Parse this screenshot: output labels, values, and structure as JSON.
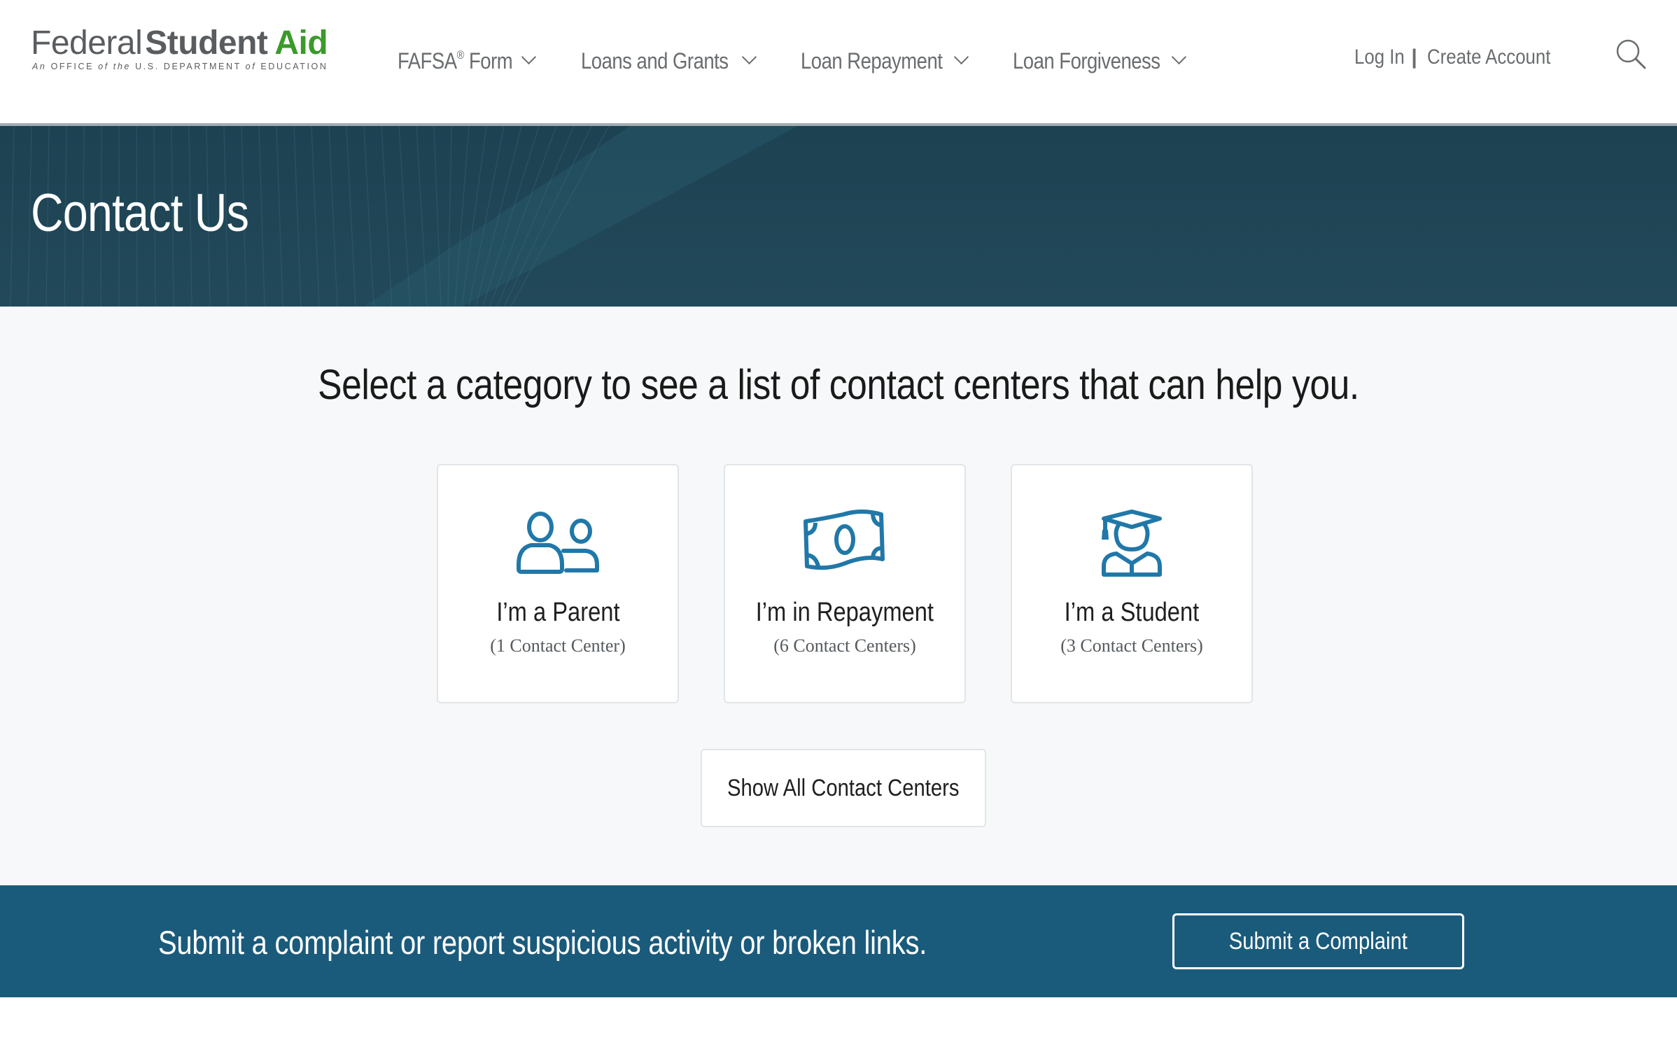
{
  "header": {
    "logo": {
      "word1": "Federal",
      "word2": "Student",
      "word3": "Aid",
      "tagline_parts": [
        "An",
        "OFFICE",
        "of",
        "the",
        "U.S. DEPARTMENT",
        "of",
        "EDUCATION"
      ]
    },
    "nav": [
      {
        "label": "FAFSA",
        "sup": "®",
        "suffix": " Form",
        "icon": "chevron-down-icon"
      },
      {
        "label": "Loans and Grants",
        "icon": "chevron-down-icon"
      },
      {
        "label": "Loan Repayment",
        "icon": "chevron-down-icon"
      },
      {
        "label": "Loan Forgiveness",
        "icon": "chevron-down-icon"
      }
    ],
    "auth": {
      "login": "Log In",
      "separator": "|",
      "create_account": "Create Account"
    },
    "search_icon": "search-icon"
  },
  "hero": {
    "title": "Contact Us"
  },
  "main": {
    "heading": "Select a category to see a list of contact centers that can help you.",
    "cards": [
      {
        "icon": "parent-users-icon",
        "title": "I’m a Parent",
        "count": "(1 Contact Center)"
      },
      {
        "icon": "money-bill-icon",
        "title": "I’m in Repayment",
        "count": "(6 Contact Centers)"
      },
      {
        "icon": "graduate-student-icon",
        "title": "I’m a Student",
        "count": "(3 Contact Centers)"
      }
    ],
    "show_all_label": "Show All Contact Centers"
  },
  "complaint_band": {
    "text": "Submit a complaint or report suspicious activity or broken links.",
    "button_label": "Submit a Complaint"
  },
  "colors": {
    "brand_green": "#3a9a2a",
    "logo_gray": "#5a5d60",
    "nav_gray": "#6a6d70",
    "hero_bg": "#1d4252",
    "icon_blue": "#2178a8",
    "band_bg": "#1a5b7c",
    "main_bg": "#f6f8f9"
  }
}
